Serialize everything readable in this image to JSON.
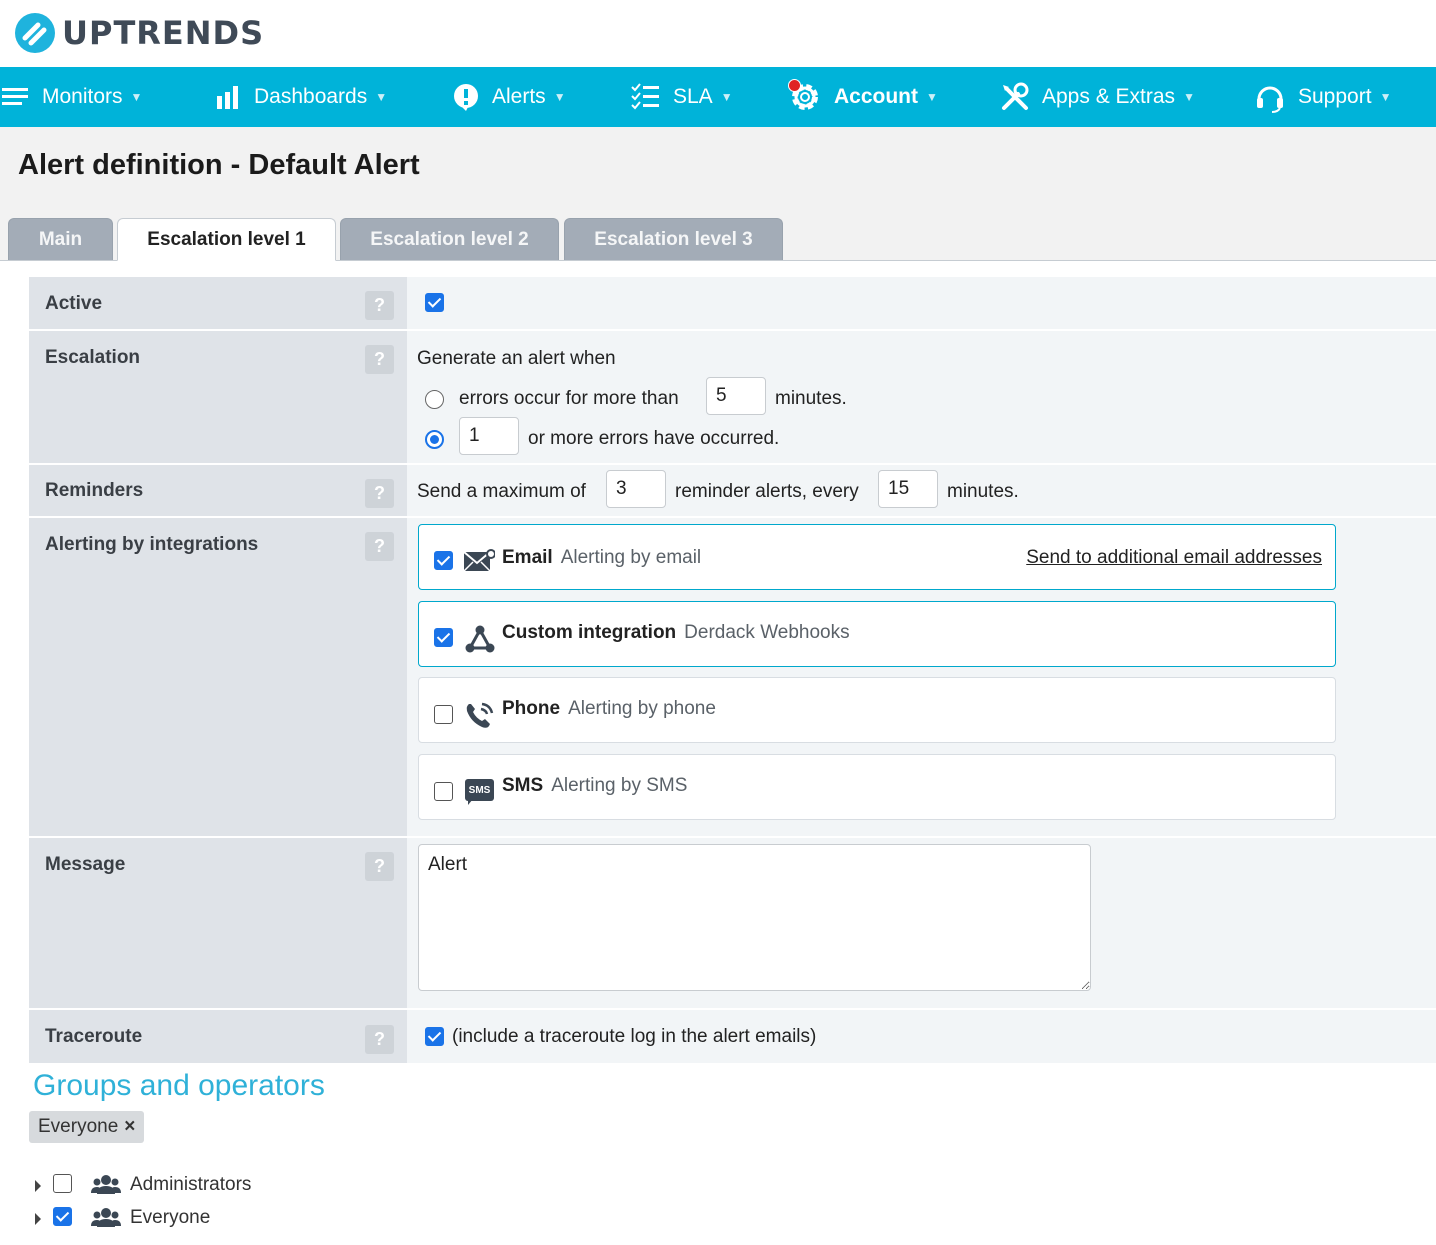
{
  "brand": {
    "name": "UPTRENDS",
    "accent": "#00b3d9",
    "icon": "uptrends-logo-icon"
  },
  "nav": [
    {
      "label": "Monitors",
      "icon": "menu-lines-icon"
    },
    {
      "label": "Dashboards",
      "icon": "bar-chart-icon"
    },
    {
      "label": "Alerts",
      "icon": "alert-exclamation-icon"
    },
    {
      "label": "SLA",
      "icon": "checklist-icon"
    },
    {
      "label": "Account",
      "icon": "gear-icon",
      "notification": true
    },
    {
      "label": "Apps & Extras",
      "icon": "tools-icon"
    },
    {
      "label": "Support",
      "icon": "headset-icon"
    }
  ],
  "page": {
    "title": "Alert definition - Default Alert"
  },
  "tabs": [
    {
      "label": "Main",
      "active": false
    },
    {
      "label": "Escalation level 1",
      "active": true
    },
    {
      "label": "Escalation level 2",
      "active": false
    },
    {
      "label": "Escalation level 3",
      "active": false
    }
  ],
  "form": {
    "help_glyph": "?",
    "active": {
      "label": "Active",
      "checked": true
    },
    "escalation": {
      "label": "Escalation",
      "intro": "Generate an alert when",
      "option1_text": "errors occur for more than",
      "option1_value": "5",
      "option1_suffix": "minutes.",
      "option2_value": "1",
      "option2_text": "or more errors have occurred.",
      "selected_option": 2
    },
    "reminders": {
      "label": "Reminders",
      "prefix": "Send a maximum of",
      "count": "3",
      "middle": "reminder alerts, every",
      "interval": "15",
      "suffix": "minutes."
    },
    "integrations": {
      "label": "Alerting by integrations",
      "items": [
        {
          "name": "Email",
          "description": "Alerting by email",
          "checked": true,
          "icon": "email-icon",
          "link": "Send to additional email addresses"
        },
        {
          "name": "Custom integration",
          "description": "Derdack Webhooks",
          "checked": true,
          "icon": "webhook-icon"
        },
        {
          "name": "Phone",
          "description": "Alerting by phone",
          "checked": false,
          "icon": "phone-icon"
        },
        {
          "name": "SMS",
          "description": "Alerting by SMS",
          "checked": false,
          "icon": "sms-icon",
          "icon_text": "SMS"
        }
      ]
    },
    "message": {
      "label": "Message",
      "value": "Alert"
    },
    "traceroute": {
      "label": "Traceroute",
      "checked": true,
      "text": "(include a traceroute log in the alert emails)"
    }
  },
  "groups": {
    "title": "Groups and operators",
    "selected_chip": "Everyone",
    "chip_remove": "×",
    "tree": [
      {
        "label": "Administrators",
        "checked": false,
        "icon": "users-group-icon"
      },
      {
        "label": "Everyone",
        "checked": true,
        "icon": "users-group-icon"
      }
    ]
  }
}
